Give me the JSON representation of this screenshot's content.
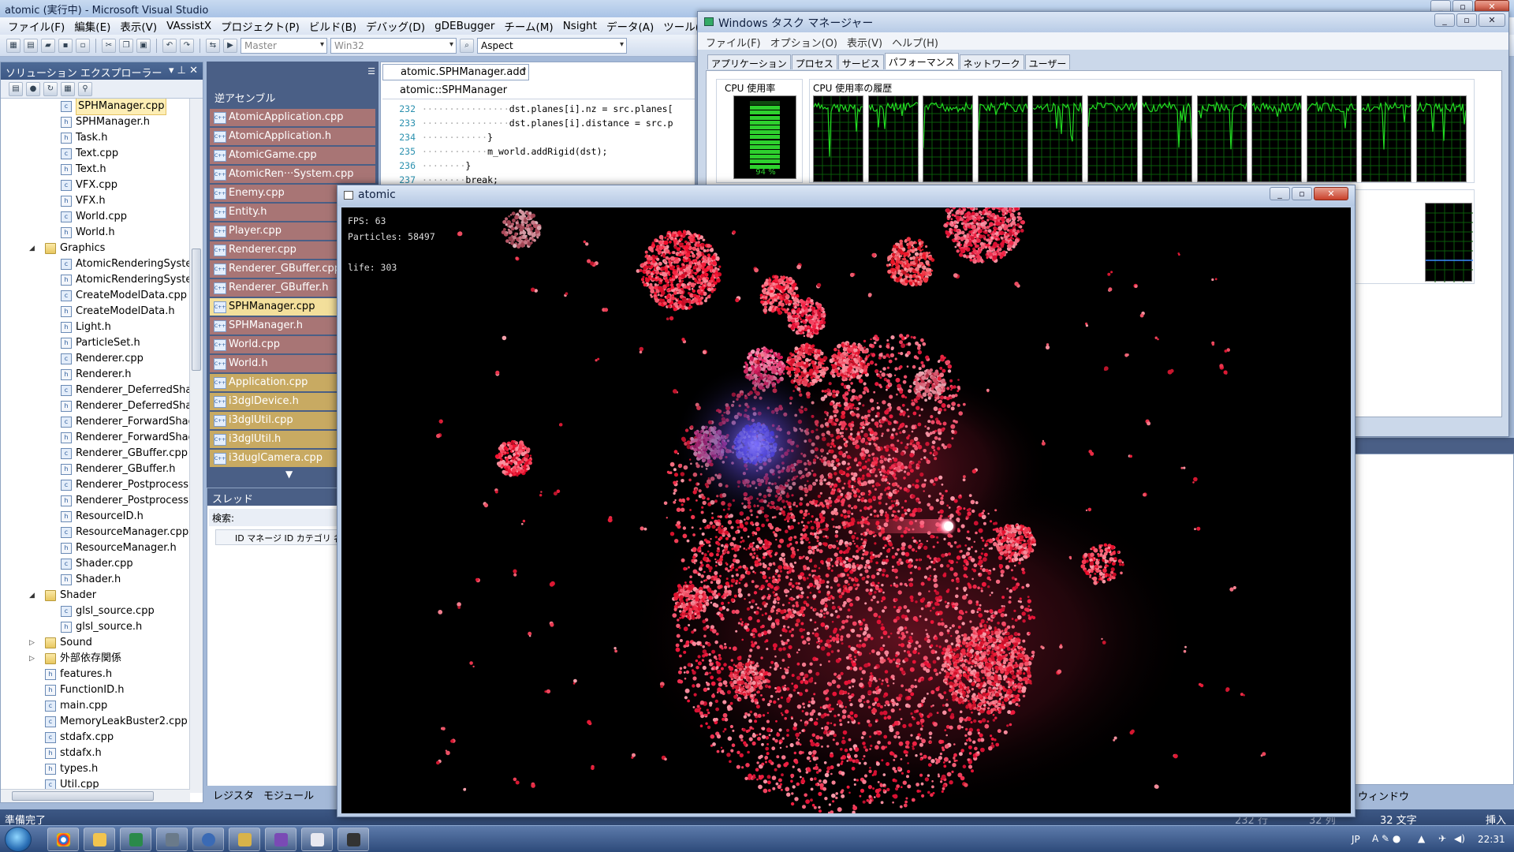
{
  "vs": {
    "title": "atomic (実行中) - Microsoft Visual Studio",
    "menu": [
      "ファイル(F)",
      "編集(E)",
      "表示(V)",
      "VAssistX",
      "プロジェクト(P)",
      "ビルド(B)",
      "デバッグ(D)",
      "gDEBugger",
      "チーム(M)",
      "Nsight",
      "データ(A)",
      "ツール(T)",
      "テスト(S)"
    ],
    "toolbar": {
      "config": "Master",
      "platform": "Win32",
      "find": "Aspect"
    },
    "status": {
      "left": "準備完了",
      "line": "232 行",
      "col": "32 列",
      "chars": "32 文字",
      "mode": "挿入"
    }
  },
  "solution": {
    "title": "ソリューション エクスプローラー",
    "items": [
      {
        "label": "SPHManager.cpp",
        "type": "cpp",
        "indent": 2,
        "selected": true
      },
      {
        "label": "SPHManager.h",
        "type": "h",
        "indent": 2
      },
      {
        "label": "Task.h",
        "type": "h",
        "indent": 2
      },
      {
        "label": "Text.cpp",
        "type": "cpp",
        "indent": 2
      },
      {
        "label": "Text.h",
        "type": "h",
        "indent": 2
      },
      {
        "label": "VFX.cpp",
        "type": "cpp",
        "indent": 2
      },
      {
        "label": "VFX.h",
        "type": "h",
        "indent": 2
      },
      {
        "label": "World.cpp",
        "type": "cpp",
        "indent": 2
      },
      {
        "label": "World.h",
        "type": "h",
        "indent": 2
      },
      {
        "label": "Graphics",
        "type": "folder",
        "indent": 1,
        "arrow": "◢"
      },
      {
        "label": "AtomicRenderingSystem",
        "type": "cpp",
        "indent": 2
      },
      {
        "label": "AtomicRenderingSystem",
        "type": "h",
        "indent": 2
      },
      {
        "label": "CreateModelData.cpp",
        "type": "cpp",
        "indent": 2
      },
      {
        "label": "CreateModelData.h",
        "type": "h",
        "indent": 2
      },
      {
        "label": "Light.h",
        "type": "h",
        "indent": 2
      },
      {
        "label": "ParticleSet.h",
        "type": "h",
        "indent": 2
      },
      {
        "label": "Renderer.cpp",
        "type": "cpp",
        "indent": 2
      },
      {
        "label": "Renderer.h",
        "type": "h",
        "indent": 2
      },
      {
        "label": "Renderer_DeferredShadi",
        "type": "cpp",
        "indent": 2
      },
      {
        "label": "Renderer_DeferredShadi",
        "type": "h",
        "indent": 2
      },
      {
        "label": "Renderer_ForwardShadir",
        "type": "cpp",
        "indent": 2
      },
      {
        "label": "Renderer_ForwardShadir",
        "type": "h",
        "indent": 2
      },
      {
        "label": "Renderer_GBuffer.cpp",
        "type": "cpp",
        "indent": 2
      },
      {
        "label": "Renderer_GBuffer.h",
        "type": "h",
        "indent": 2
      },
      {
        "label": "Renderer_Postprocess.cp",
        "type": "cpp",
        "indent": 2
      },
      {
        "label": "Renderer_Postprocess.h",
        "type": "h",
        "indent": 2
      },
      {
        "label": "ResourceID.h",
        "type": "h",
        "indent": 2
      },
      {
        "label": "ResourceManager.cpp",
        "type": "cpp",
        "indent": 2
      },
      {
        "label": "ResourceManager.h",
        "type": "h",
        "indent": 2
      },
      {
        "label": "Shader.cpp",
        "type": "cpp",
        "indent": 2
      },
      {
        "label": "Shader.h",
        "type": "h",
        "indent": 2
      },
      {
        "label": "Shader",
        "type": "folder",
        "indent": 1,
        "arrow": "◢"
      },
      {
        "label": "glsl_source.cpp",
        "type": "cpp",
        "indent": 2
      },
      {
        "label": "glsl_source.h",
        "type": "h",
        "indent": 2
      },
      {
        "label": "Sound",
        "type": "folder",
        "indent": 1,
        "arrow": "▷"
      },
      {
        "label": "外部依存関係",
        "type": "folder",
        "indent": 1,
        "arrow": "▷"
      },
      {
        "label": "features.h",
        "type": "h",
        "indent": 1
      },
      {
        "label": "FunctionID.h",
        "type": "h",
        "indent": 1
      },
      {
        "label": "main.cpp",
        "type": "cpp",
        "indent": 1
      },
      {
        "label": "MemoryLeakBuster2.cpp",
        "type": "cpp",
        "indent": 1
      },
      {
        "label": "stdafx.cpp",
        "type": "cpp",
        "indent": 1
      },
      {
        "label": "stdafx.h",
        "type": "h",
        "indent": 1
      },
      {
        "label": "types.h",
        "type": "h",
        "indent": 1
      },
      {
        "label": "Util.cpp",
        "type": "cpp",
        "indent": 1
      }
    ]
  },
  "files": {
    "header": "逆アセンブル",
    "items": [
      {
        "label": "AtomicApplication.cpp",
        "style": "cpp"
      },
      {
        "label": "AtomicApplication.h",
        "style": "cpp"
      },
      {
        "label": "AtomicGame.cpp",
        "style": "cpp"
      },
      {
        "label": "AtomicRen···System.cpp",
        "style": "cpp"
      },
      {
        "label": "Enemy.cpp",
        "style": "cpp"
      },
      {
        "label": "Entity.h",
        "style": "cpp"
      },
      {
        "label": "Player.cpp",
        "style": "cpp"
      },
      {
        "label": "Renderer.cpp",
        "style": "cpp"
      },
      {
        "label": "Renderer_GBuffer.cpp",
        "style": "cpp"
      },
      {
        "label": "Renderer_GBuffer.h",
        "style": "cpp"
      },
      {
        "label": "SPHManager.cpp",
        "style": "sel"
      },
      {
        "label": "SPHManager.h",
        "style": "cpp"
      },
      {
        "label": "World.cpp",
        "style": "cpp"
      },
      {
        "label": "World.h",
        "style": "cpp"
      },
      {
        "label": "Application.cpp",
        "style": "y"
      },
      {
        "label": "i3dglDevice.h",
        "style": "y"
      },
      {
        "label": "i3dglUtil.cpp",
        "style": "y"
      },
      {
        "label": "i3dglUtil.h",
        "style": "y"
      },
      {
        "label": "i3duglCamera.cpp",
        "style": "y"
      }
    ]
  },
  "editor": {
    "nav_member": "atomic.SPHManager.add",
    "nav_class": "atomic::SPHManager",
    "lines": [
      {
        "n": "232",
        "indent": "················",
        "code": "dst.planes[i].nz = src.planes["
      },
      {
        "n": "233",
        "indent": "················",
        "code": "dst.planes[i].distance = src.p"
      },
      {
        "n": "234",
        "indent": "············",
        "code": "}"
      },
      {
        "n": "235",
        "indent": "············",
        "code": "m_world.addRigid(dst);"
      },
      {
        "n": "236",
        "indent": "········",
        "code": "}"
      },
      {
        "n": "237",
        "indent": "········",
        "code": "break;"
      }
    ]
  },
  "threads": {
    "title": "スレッド",
    "search": "検索:",
    "cols": "ID マネージ ID カテゴリ 名前"
  },
  "bottom_tabs": [
    "レジスタ",
    "モジュール"
  ],
  "right_bottom": "ウィンドウ",
  "taskmgr": {
    "title": "Windows タスク マネージャー",
    "menu": [
      "ファイル(F)",
      "オプション(O)",
      "表示(V)",
      "ヘルプ(H)"
    ],
    "tabs": [
      "アプリケーション",
      "プロセス",
      "サービス",
      "パフォーマンス",
      "ネットワーク",
      "ユーザー"
    ],
    "active_tab": 3,
    "cpu_label": "CPU 使用率",
    "cpu_value": "94 %",
    "cpu_usage": 94,
    "history_label": "CPU 使用率の履歴",
    "core_count": 12,
    "graph_color": "#22dd22"
  },
  "game": {
    "title": "atomic",
    "fps_line": "FPS: 63",
    "particles_line": "Particles: 58497",
    "life_line": "life: 303"
  },
  "taskbar": {
    "time": "22:31",
    "lang": "JP"
  }
}
